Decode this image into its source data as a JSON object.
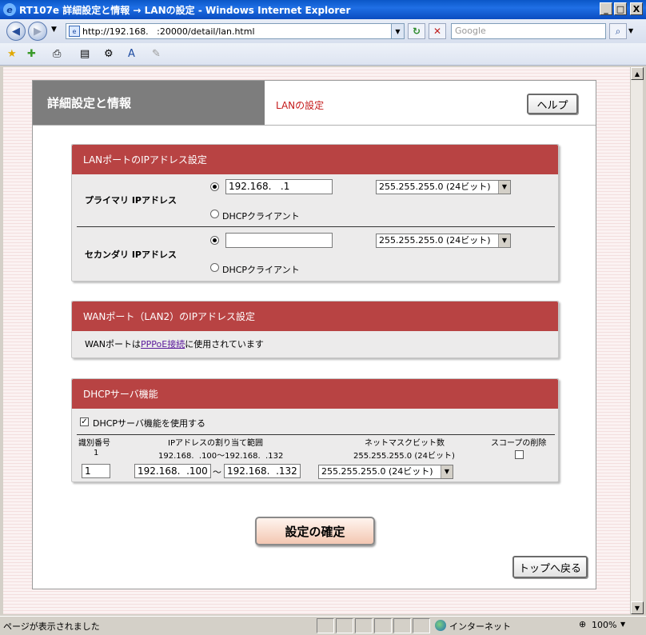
{
  "window": {
    "title": "RT107e 詳細設定と情報 → LANの設定 - Windows Internet Explorer",
    "minimize": "_",
    "maximize": "□",
    "close": "X"
  },
  "navbar": {
    "url": "http://192.168.   :20000/detail/lan.html",
    "search_placeholder": "Google"
  },
  "page": {
    "title": "詳細設定と情報",
    "subtitle": "LANの設定",
    "help_button": "ヘルプ",
    "confirm_button": "設定の確定",
    "top_button": "トップへ戻る"
  },
  "lan_section": {
    "title": "LANポートのIPアドレス設定",
    "primary": {
      "label": "プライマリ IPアドレス",
      "ip_value": "192.168.   .1",
      "mask_value": "255.255.255.0 (24ビット)",
      "dhcp_label": "DHCPクライアント"
    },
    "secondary": {
      "label": "セカンダリ IPアドレス",
      "ip_value": "",
      "mask_value": "255.255.255.0 (24ビット)",
      "dhcp_label": "DHCPクライアント"
    }
  },
  "wan_section": {
    "title": "WANポート（LAN2）のIPアドレス設定",
    "text_before": "WANポートは",
    "link": "PPPoE接続",
    "text_after": "に使用されています"
  },
  "dhcp_section": {
    "title": "DHCPサーバ機能",
    "enable_label": "DHCPサーバ機能を使用する",
    "enable_checked": true,
    "columns": [
      "識別番号",
      "IPアドレスの割り当て範囲",
      "ネットマスクビット数",
      "スコープの削除"
    ],
    "rows": [
      {
        "id": "1",
        "range": "192.168.  .100〜192.168.  .132",
        "mask": "255.255.255.0 (24ビット)"
      }
    ],
    "edit": {
      "id": "1",
      "range_start": "192.168.  .100",
      "tilde": "〜",
      "range_end": "192.168.  .132",
      "mask": "255.255.255.0 (24ビット)"
    }
  },
  "statusbar": {
    "text": "ページが表示されました",
    "zone": "インターネット",
    "zoom": "100%"
  }
}
